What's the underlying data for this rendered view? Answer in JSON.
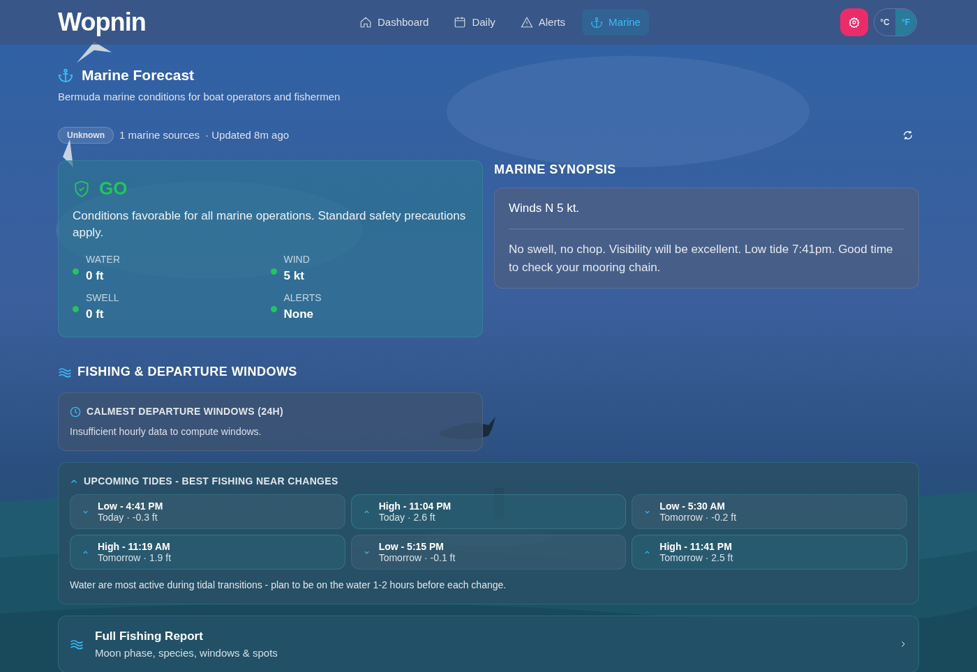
{
  "brand": "Wopnin",
  "nav": [
    {
      "label": "Dashboard",
      "selected": false
    },
    {
      "label": "Daily",
      "selected": false
    },
    {
      "label": "Alerts",
      "selected": false
    },
    {
      "label": "Marine",
      "selected": true
    }
  ],
  "units": [
    {
      "label": "°C",
      "selected": false
    },
    {
      "label": "°F",
      "selected": true
    }
  ],
  "header": {
    "title": "Marine Forecast",
    "subtitle": "Bermuda marine conditions for boat operators and fishermen",
    "badge": "Unknown",
    "sources": "1 marine sources",
    "updated": "· Updated 8m ago"
  },
  "status": {
    "verdict": "GO",
    "message": "Conditions favorable for all marine operations. Standard safety precautions apply.",
    "metrics": [
      {
        "label": "WATER",
        "value": "0 ft",
        "color": "#22c55e"
      },
      {
        "label": "WIND",
        "value": "5 kt",
        "color": "#22c55e"
      },
      {
        "label": "SWELL",
        "value": "0 ft",
        "color": "#22c55e"
      },
      {
        "label": "ALERTS",
        "value": "None",
        "color": "#22c55e"
      }
    ]
  },
  "synopsis": {
    "title": "MARINE SYNOPSIS",
    "lead": "Winds N 5 kt.",
    "body": "No swell, no chop. Visibility will be excellent. Low tide 7:41pm. Good time to check your mooring chain."
  },
  "fishing": {
    "title": "FISHING & DEPARTURE WINDOWS",
    "windows_title": "CALMEST DEPARTURE WINDOWS (24H)",
    "windows_text": "Insufficient hourly data to compute windows."
  },
  "tides": {
    "title": "UPCOMING TIDES - BEST FISHING NEAR CHANGES",
    "expanded": true,
    "items": [
      {
        "kind": "low",
        "label": "Low - 4:41 PM",
        "detail": "Today · -0.3 ft"
      },
      {
        "kind": "high",
        "label": "High - 11:04 PM",
        "detail": "Today · 2.6 ft"
      },
      {
        "kind": "low",
        "label": "Low - 5:30 AM",
        "detail": "Tomorrow · -0.2 ft"
      },
      {
        "kind": "high",
        "label": "High - 11:19 AM",
        "detail": "Tomorrow · 1.9 ft"
      },
      {
        "kind": "low",
        "label": "Low - 5:15 PM",
        "detail": "Tomorrow · -0.1 ft"
      },
      {
        "kind": "high",
        "label": "High - 11:41 PM",
        "detail": "Tomorrow · 2.5 ft"
      }
    ],
    "note": "Water are most active during tidal transitions - plan to be on the water 1-2 hours before each change."
  },
  "report": {
    "title": "Full Fishing Report",
    "subtitle": "Moon phase, species, windows & spots"
  }
}
